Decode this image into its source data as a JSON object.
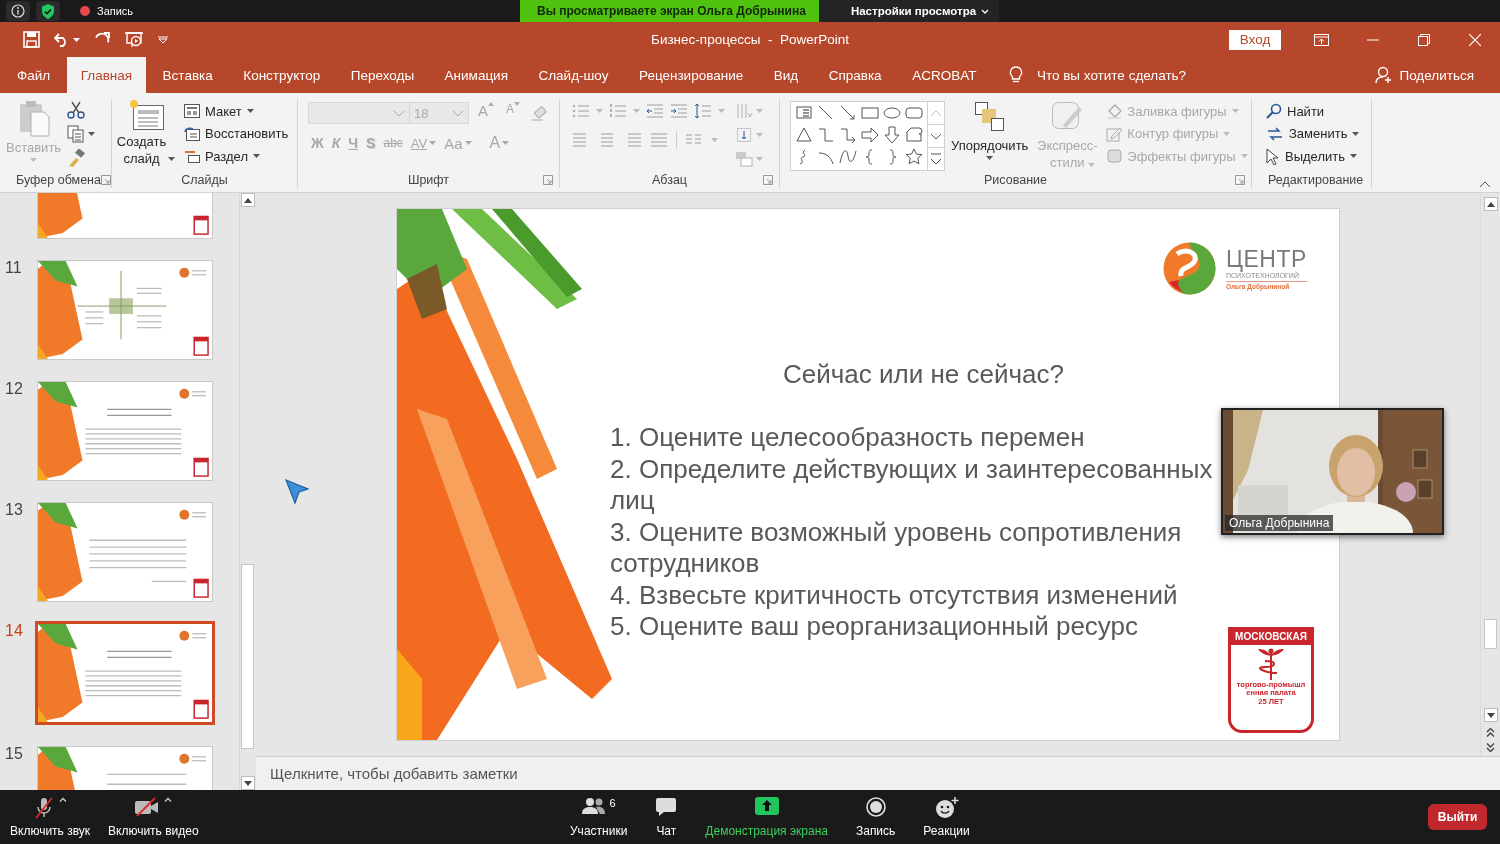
{
  "zoom_top_bar": {
    "recording_label": "Запись",
    "share_banner": "Вы просматриваете экран Ольга Добрынина",
    "view_options": "Настройки просмотра"
  },
  "window": {
    "title": "Бизнес-процессы  -  PowerPoint",
    "sign_in": "Вход"
  },
  "tabs": [
    {
      "label": "Файл",
      "selected": false
    },
    {
      "label": "Главная",
      "selected": true
    },
    {
      "label": "Вставка",
      "selected": false
    },
    {
      "label": "Конструктор",
      "selected": false
    },
    {
      "label": "Переходы",
      "selected": false
    },
    {
      "label": "Анимация",
      "selected": false
    },
    {
      "label": "Слайд-шоу",
      "selected": false
    },
    {
      "label": "Рецензирование",
      "selected": false
    },
    {
      "label": "Вид",
      "selected": false
    },
    {
      "label": "Справка",
      "selected": false
    },
    {
      "label": "ACROBAT",
      "selected": false
    }
  ],
  "tell_me": "Что вы хотите сделать?",
  "share": "Поделиться",
  "ribbon": {
    "clipboard": {
      "title": "Буфер обмена",
      "paste": {
        "label": "Вставить",
        "disabled": true
      }
    },
    "slides": {
      "title": "Слайды",
      "new_slide": "Создать слайд",
      "commands": [
        {
          "kind": "layout",
          "label": "Макет",
          "menu": true
        },
        {
          "kind": "reset",
          "label": "Восстановить",
          "menu": false
        },
        {
          "kind": "section",
          "label": "Раздел",
          "menu": true
        }
      ]
    },
    "font": {
      "title": "Шрифт",
      "disabled": true,
      "size": "18",
      "size_buttons": [
        {
          "kind": "grow",
          "label": "A"
        },
        {
          "kind": "shrink",
          "label": "A"
        }
      ],
      "format_buttons": [
        {
          "kind": "bold",
          "label": "Ж",
          "menu": false
        },
        {
          "kind": "italic",
          "label": "К",
          "menu": false
        },
        {
          "kind": "underline",
          "label": "Ч",
          "menu": false
        },
        {
          "kind": "shadow",
          "label": "S",
          "menu": false
        },
        {
          "kind": "strike",
          "label": "abc",
          "menu": false
        },
        {
          "kind": "spacing",
          "label": "AV",
          "menu": true
        },
        {
          "kind": "case",
          "label": "Aa",
          "menu": true
        },
        {
          "kind": "color",
          "label": "A",
          "menu": true
        }
      ]
    },
    "paragraph": {
      "title": "Абзац",
      "disabled": true
    },
    "drawing": {
      "title": "Рисование",
      "arrange": "Упорядочить",
      "quick_styles": {
        "label": "Экспресс-стили",
        "disabled": true
      },
      "shape_commands": [
        {
          "kind": "fill",
          "label": "Заливка фигуры",
          "disabled": true
        },
        {
          "kind": "outline",
          "label": "Контур фигуры",
          "disabled": true
        },
        {
          "kind": "effects",
          "label": "Эффекты фигуры",
          "disabled": true
        }
      ]
    },
    "editing": {
      "title": "Редактирование",
      "commands": [
        {
          "kind": "find",
          "label": "Найти",
          "menu": false
        },
        {
          "kind": "replace",
          "label": "Заменить",
          "menu": true
        },
        {
          "kind": "select",
          "label": "Выделить",
          "menu": true
        }
      ]
    }
  },
  "thumbnails": [
    {
      "kind": "table",
      "selected": false
    },
    {
      "number": "11",
      "kind": "diagram",
      "selected": false
    },
    {
      "number": "12",
      "kind": "list",
      "selected": false
    },
    {
      "number": "13",
      "kind": "quote",
      "selected": false
    },
    {
      "number": "14",
      "kind": "list",
      "selected": true
    },
    {
      "number": "15",
      "kind": "closing",
      "selected": false
    }
  ],
  "slide": {
    "title": "Сейчас или не сейчас?",
    "items": [
      "1. Оцените целесообразность перемен",
      "2. Определите действующих и заинтересованных лиц",
      "3. Оцените возможный уровень сопротивления сотрудников",
      "4. Взвесьте критичность отсутствия изменений",
      "5. Оцените ваш реорганизационный ресурс"
    ],
    "center_logo": {
      "name": "ЦЕНТР",
      "subtitle": "ПСИХОТЕХНОЛОГИЙ",
      "author": "Ольга Добрыниной"
    },
    "emblem": {
      "title": "МОСКОВСКАЯ",
      "text": "торгово-промышленная палата",
      "years": "25 ЛЕТ"
    }
  },
  "notes": {
    "placeholder": "Щелкните, чтобы добавить заметки"
  },
  "video": {
    "kind": "picture",
    "name": "Ольга Добрынина"
  },
  "meeting_controls": [
    {
      "kind": "mic",
      "label": "Включить звук",
      "menu": true
    },
    {
      "kind": "video",
      "label": "Включить видео",
      "menu": true
    },
    {
      "kind": "participants",
      "label": "Участники",
      "count": "6",
      "menu": false
    },
    {
      "kind": "chat",
      "label": "Чат",
      "menu": false
    },
    {
      "kind": "share",
      "label": "Демонстрация экрана",
      "menu": false
    },
    {
      "kind": "record",
      "label": "Запись",
      "menu": false
    },
    {
      "kind": "reactions",
      "label": "Реакции",
      "menu": false
    }
  ],
  "leave": "Выйти"
}
